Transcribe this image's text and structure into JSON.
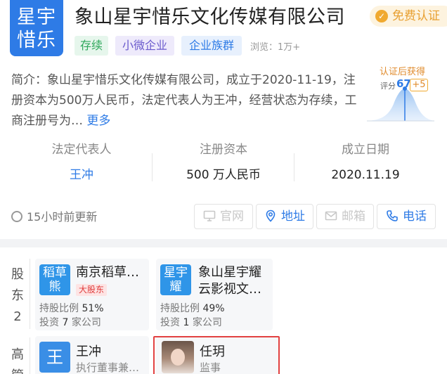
{
  "company": {
    "logo_text_line1": "星宇",
    "logo_text_line2": "惜乐",
    "name": "象山星宇惜乐文化传媒有限公司",
    "certification": "免费认证",
    "tags": [
      "存续",
      "小微企业",
      "企业族群"
    ],
    "views": "浏览：1万+",
    "intro": "简介：象山星宇惜乐文化传媒有限公司，成立于2020-11-19，注册资本为500万人民币，法定代表人为王冲，经营状态为存续，工商注册号为…",
    "more_link": "更多"
  },
  "score": {
    "title": "认证后获得",
    "label": "评分",
    "value": "67",
    "plus": "+5"
  },
  "stats": [
    {
      "label": "法定代表人",
      "value": "王冲"
    },
    {
      "label": "注册资本",
      "value": "500 万人民币"
    },
    {
      "label": "成立日期",
      "value": "2020.11.19"
    }
  ],
  "update_text": "15小时前更新",
  "actions": [
    {
      "label": "官网",
      "icon": "monitor-icon",
      "enabled": false
    },
    {
      "label": "地址",
      "icon": "location-pin-icon",
      "enabled": true
    },
    {
      "label": "邮箱",
      "icon": "mail-icon",
      "enabled": false
    },
    {
      "label": "电话",
      "icon": "phone-icon",
      "enabled": true
    }
  ],
  "shareholders": {
    "side_label": [
      "股",
      "东",
      "2"
    ],
    "items": [
      {
        "logo_line1": "稻草",
        "logo_line2": "熊",
        "name": "南京稻草…",
        "badge": "大股东",
        "ratio_label": "持股比例",
        "ratio": "51%",
        "invest_prefix": "投资",
        "invest_count": "7",
        "invest_suffix": "家公司"
      },
      {
        "logo_line1": "星宇",
        "logo_line2": "耀",
        "name_line1": "象山星宇耀",
        "name_line2": "云影视文…",
        "ratio_label": "持股比例",
        "ratio": "49%",
        "invest_prefix": "投资",
        "invest_count": "1",
        "invest_suffix": "家公司"
      }
    ]
  },
  "executives": {
    "side_label": [
      "高",
      "管"
    ],
    "items": [
      {
        "avatar": "王",
        "name": "王冲",
        "role": "执行董事兼…"
      },
      {
        "name": "任玥",
        "role": "监事"
      }
    ]
  }
}
